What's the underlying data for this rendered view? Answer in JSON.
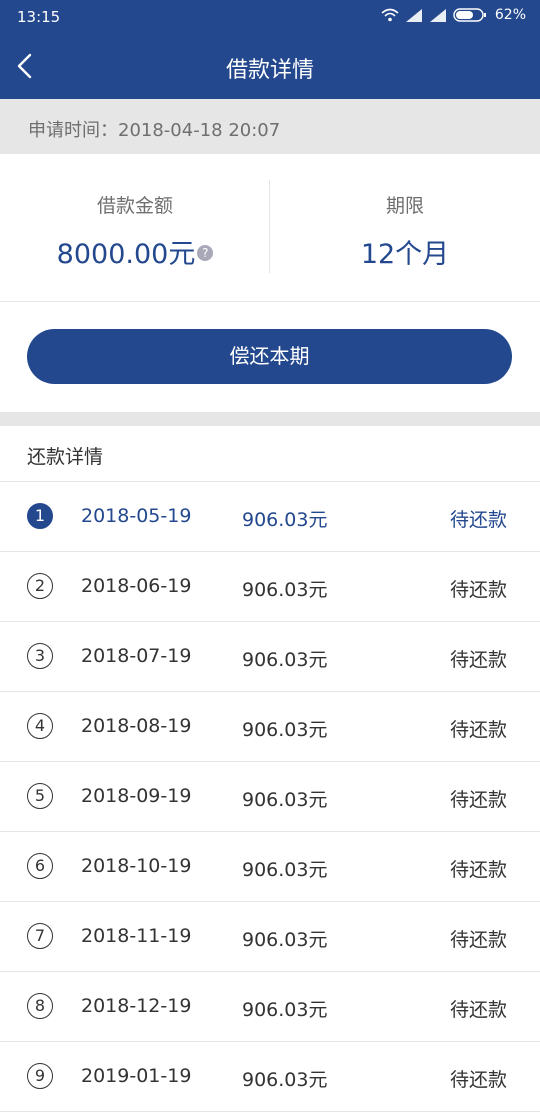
{
  "status_bar": {
    "time": "13:15",
    "battery": "62%"
  },
  "header": {
    "title": "借款详情"
  },
  "apply": {
    "text": "申请时间：2018-04-18 20:07"
  },
  "summary": {
    "amount_label": "借款金额",
    "amount_value": "8000.00元",
    "term_label": "期限",
    "term_value": "12个月"
  },
  "repay_button": "偿还本期",
  "section_title": "还款详情",
  "installments": [
    {
      "num": "1",
      "date": "2018-05-19",
      "amount": "906.03元",
      "status": "待还款"
    },
    {
      "num": "2",
      "date": "2018-06-19",
      "amount": "906.03元",
      "status": "待还款"
    },
    {
      "num": "3",
      "date": "2018-07-19",
      "amount": "906.03元",
      "status": "待还款"
    },
    {
      "num": "4",
      "date": "2018-08-19",
      "amount": "906.03元",
      "status": "待还款"
    },
    {
      "num": "5",
      "date": "2018-09-19",
      "amount": "906.03元",
      "status": "待还款"
    },
    {
      "num": "6",
      "date": "2018-10-19",
      "amount": "906.03元",
      "status": "待还款"
    },
    {
      "num": "7",
      "date": "2018-11-19",
      "amount": "906.03元",
      "status": "待还款"
    },
    {
      "num": "8",
      "date": "2018-12-19",
      "amount": "906.03元",
      "status": "待还款"
    },
    {
      "num": "9",
      "date": "2019-01-19",
      "amount": "906.03元",
      "status": "待还款"
    }
  ],
  "colors": {
    "primary": "#23488e",
    "background_gray": "#e6e6e6"
  }
}
